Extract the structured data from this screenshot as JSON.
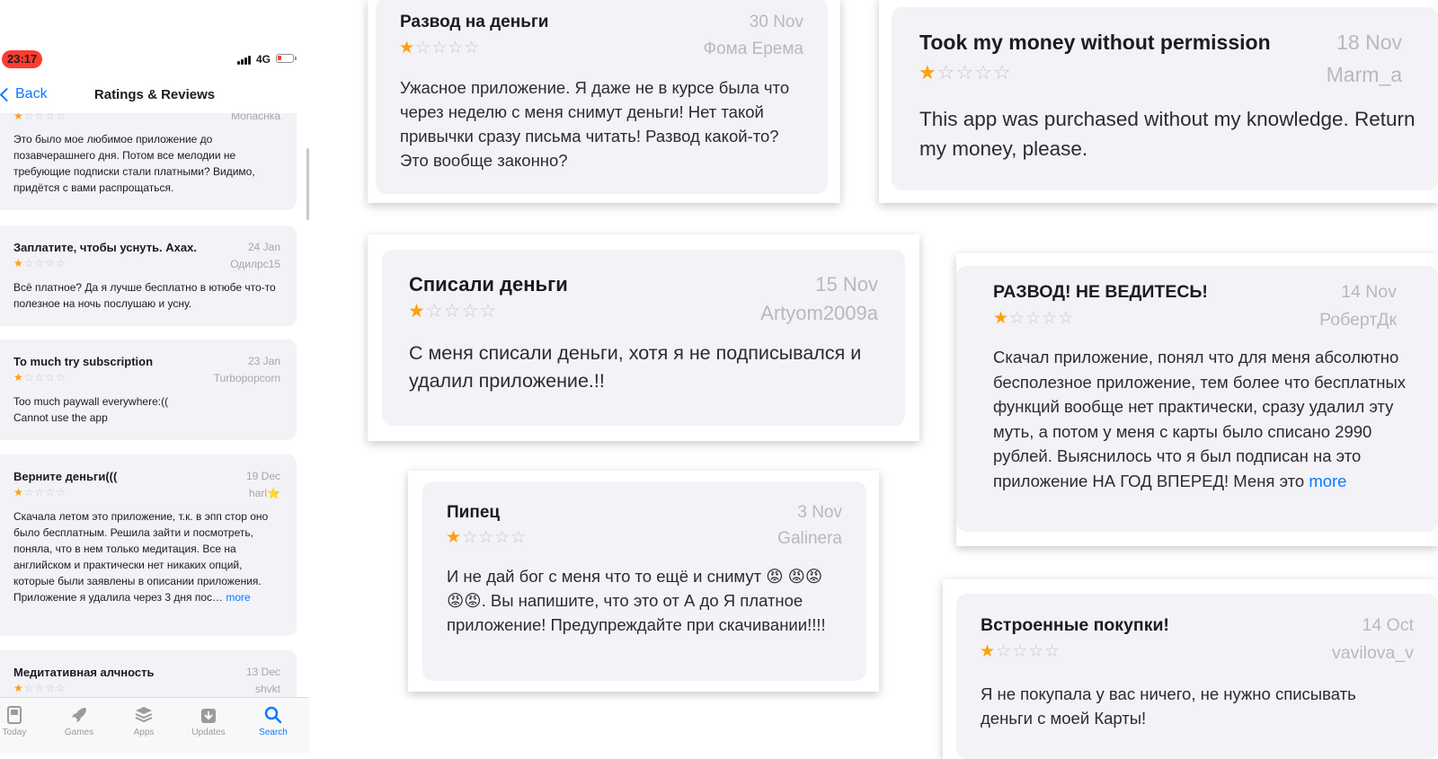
{
  "phone": {
    "status": {
      "time": "23:17",
      "network": "4G"
    },
    "nav": {
      "back_label": "Back",
      "title": "Ratings & Reviews"
    },
    "reviews": [
      {
        "title": "",
        "date": "",
        "user": "Monacнка",
        "rating": 1,
        "body": "Это было мое любимое приложение до позавчерашнего дня. Потом все мелодии не требующие подписки стали платными? Видимо, придётся с вами распрощаться."
      },
      {
        "title": "Заплатите, чтобы уснуть. Axax.",
        "date": "24 Jan",
        "user": "Одилрс15",
        "rating": 1,
        "body": "Всё платное? Да я лучше бесплатно в ютюбе что-то полезное на ночь послушаю и усну."
      },
      {
        "title": "To much try subscription",
        "date": "23 Jan",
        "user": "Turbopopcorn",
        "rating": 1,
        "body": "Too much paywall everywhere:(( Cannot use the app"
      },
      {
        "title": "Верните деньги(((",
        "date": "19 Dec",
        "user": "harl⭐",
        "rating": 1,
        "body": "Скачала летом это приложение, т.к. в эпп стор оно было бесплатным. Решила зайти и посмотреть, поняла, что в нем только медитация. Все на английском и практически нет никаких опций, которые были заявлены в описании приложения. Приложение я удалила через 3 дня пос…",
        "more": "more"
      },
      {
        "title": "Медитативная алчность",
        "date": "13 Dec",
        "user": "shvkt",
        "rating": 1,
        "body": ""
      }
    ],
    "tabs": [
      {
        "label": "Today",
        "icon": "today-icon"
      },
      {
        "label": "Games",
        "icon": "rocket-icon"
      },
      {
        "label": "Apps",
        "icon": "apps-stack-icon"
      },
      {
        "label": "Updates",
        "icon": "updates-download-icon"
      },
      {
        "label": "Search",
        "icon": "search-icon",
        "active": true
      }
    ]
  },
  "cards": [
    {
      "title": "Развод на деньги",
      "date": "30 Nov",
      "user": "Фома Ерема",
      "rating": 1,
      "body": "Ужасное приложение. Я даже не в курсе была что через неделю с меня снимут деньги! Нет такой привычки сразу письма читать! Развод какой-то? Это вообще законно?"
    },
    {
      "title": "Took my money without permission",
      "date": "18 Nov",
      "user": "Marm_a",
      "rating": 1,
      "body": "This app was purchased without my knowledge. Return my money, please."
    },
    {
      "title": "Списали деньги",
      "date": "15 Nov",
      "user": "Artyom2009a",
      "rating": 1,
      "body": "С меня списали деньги, хотя я не подписывался и удалил приложение.!!"
    },
    {
      "title": "РАЗВОД! НЕ ВЕДИТЕСЬ!",
      "date": "14 Nov",
      "user": "РобертДк",
      "rating": 1,
      "body": "Скачал приложение, понял что для меня абсолютно бесполезное приложение, тем более что бесплатных функций вообще нет практически, сразу удалил эту муть, а потом у меня с карты было списано 2990 рублей. Выяснилось что я был подписан на это приложение НА ГОД ВПЕРЕД! Меня это",
      "more": "more"
    },
    {
      "title": "Пипец",
      "date": "3 Nov",
      "user": "Galinera",
      "rating": 1,
      "body": "И не дай бог с меня что то ещё и снимут 😡 😡😡😡😡. Вы напишите, что это от А до Я платное приложение! Предупреждайте при скачивании!!!!"
    },
    {
      "title": "Встроенные покупки!",
      "date": "14 Oct",
      "user": "vavilova_v",
      "rating": 1,
      "body": "Я не покупала у вас ничего, не нужно списывать деньги с моей Карты!"
    }
  ],
  "colors": {
    "accent": "#0a7aff",
    "star": "#ff9f0a",
    "card_bg": "#f2f2f7",
    "time_pill": "#ff3b30"
  }
}
